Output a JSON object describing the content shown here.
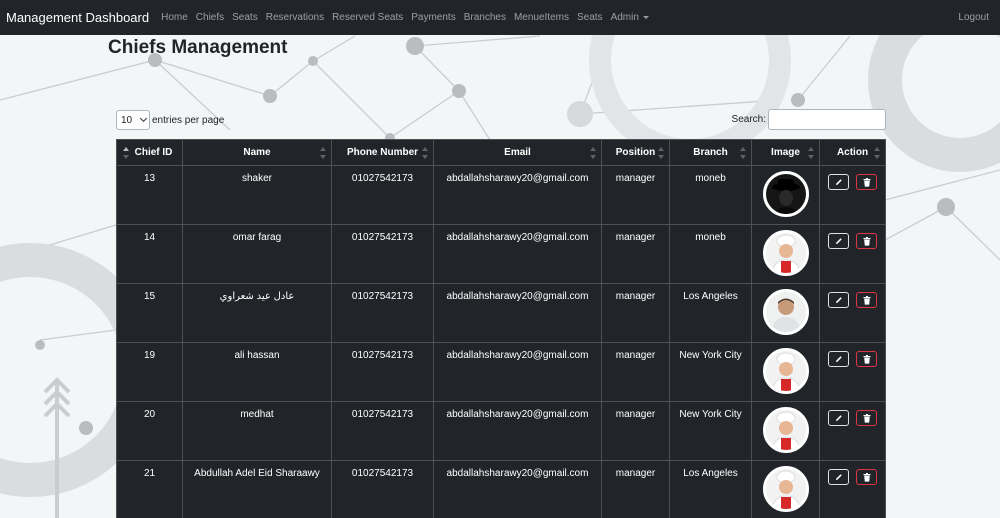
{
  "navbar": {
    "brand": "Management Dashboard",
    "items": [
      {
        "label": "Home"
      },
      {
        "label": "Chiefs"
      },
      {
        "label": "Seats"
      },
      {
        "label": "Reservations"
      },
      {
        "label": "Reserved Seats"
      },
      {
        "label": "Payments"
      },
      {
        "label": "Branches"
      },
      {
        "label": "MenueItems"
      },
      {
        "label": "Seats"
      },
      {
        "label": "Admin"
      }
    ],
    "logout": "Logout"
  },
  "page": {
    "title": "Chiefs Management",
    "entries_value": "10",
    "entries_label": "entries per page",
    "search_label": "Search:",
    "search_value": ""
  },
  "table": {
    "headers": [
      "Chief ID",
      "Name",
      "Phone Number",
      "Email",
      "Position",
      "Branch",
      "Image",
      "Action"
    ],
    "rows": [
      {
        "id": "13",
        "name": "shaker",
        "phone": "01027542173",
        "email": "abdallahsharawy20@gmail.com",
        "position": "manager",
        "branch": "moneb",
        "image": "dark-hat-avatar"
      },
      {
        "id": "14",
        "name": "omar farag",
        "phone": "01027542173",
        "email": "abdallahsharawy20@gmail.com",
        "position": "manager",
        "branch": "moneb",
        "image": "chef-avatar"
      },
      {
        "id": "15",
        "name": "عادل عيد شعراوي",
        "phone": "01027542173",
        "email": "abdallahsharawy20@gmail.com",
        "position": "manager",
        "branch": "Los Angeles",
        "image": "man-avatar"
      },
      {
        "id": "19",
        "name": "ali hassan",
        "phone": "01027542173",
        "email": "abdallahsharawy20@gmail.com",
        "position": "manager",
        "branch": "New York City",
        "image": "chef-avatar"
      },
      {
        "id": "20",
        "name": "medhat",
        "phone": "01027542173",
        "email": "abdallahsharawy20@gmail.com",
        "position": "manager",
        "branch": "New York City",
        "image": "chef-avatar"
      },
      {
        "id": "21",
        "name": "Abdullah Adel Eid Sharaawy",
        "phone": "01027542173",
        "email": "abdallahsharawy20@gmail.com",
        "position": "manager",
        "branch": "Los Angeles",
        "image": "chef-avatar"
      }
    ]
  },
  "colors": {
    "navbar_bg": "#212529",
    "table_bg": "#212529",
    "delete_accent": "#dc3545"
  },
  "icons": {
    "edit": "pencil-icon",
    "delete": "trash-icon"
  }
}
